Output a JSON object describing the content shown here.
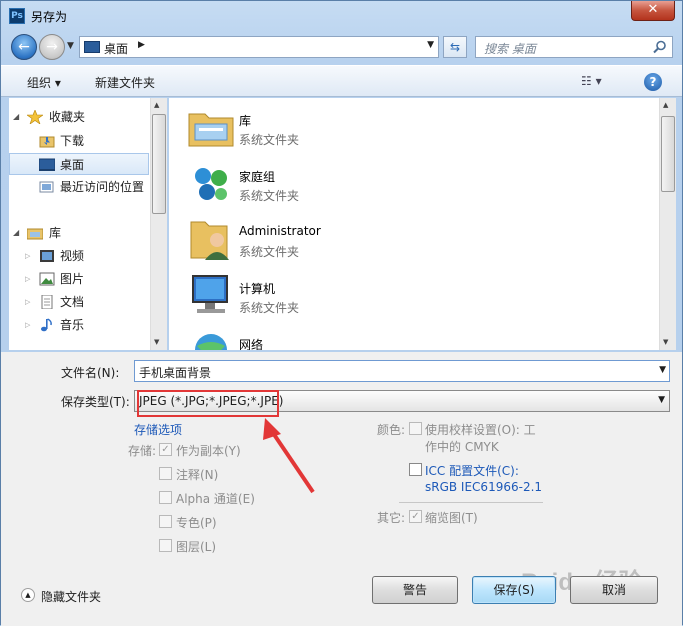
{
  "window": {
    "title": "另存为",
    "app_icon_text": "Ps"
  },
  "navbar": {
    "address": "桌面",
    "search_placeholder": "搜索 桌面"
  },
  "toolbar": {
    "organize": "组织 ▾",
    "new_folder": "新建文件夹",
    "help": "?"
  },
  "sidebar": {
    "items": [
      {
        "label": "收藏夹",
        "icon": "star-icon"
      },
      {
        "label": "下载",
        "icon": "download-folder-icon"
      },
      {
        "label": "桌面",
        "icon": "desktop-icon",
        "selected": true
      },
      {
        "label": "最近访问的位置",
        "icon": "recent-places-icon"
      },
      {
        "label": "库",
        "icon": "library-icon"
      },
      {
        "label": "视频",
        "icon": "video-icon"
      },
      {
        "label": "图片",
        "icon": "pictures-icon"
      },
      {
        "label": "文档",
        "icon": "documents-icon"
      },
      {
        "label": "音乐",
        "icon": "music-icon"
      }
    ]
  },
  "files": [
    {
      "name": "库",
      "type": "系统文件夹",
      "icon": "library-folder-icon"
    },
    {
      "name": "家庭组",
      "type": "系统文件夹",
      "icon": "homegroup-icon"
    },
    {
      "name": "Administrator",
      "type": "系统文件夹",
      "icon": "user-folder-icon"
    },
    {
      "name": "计算机",
      "type": "系统文件夹",
      "icon": "computer-icon"
    },
    {
      "name": "网络",
      "type": "",
      "icon": "network-icon"
    }
  ],
  "form": {
    "filename_label": "文件名(N):",
    "filename_value": "手机桌面背景",
    "filetype_label": "保存类型(T):",
    "filetype_value": "JPEG (*.JPG;*.JPEG;*.JPE)",
    "storage_options_link": "存储选项",
    "storage_label": "存储:",
    "storage_options": [
      {
        "label": "作为副本(Y)",
        "checked": true
      },
      {
        "label": "注释(N)",
        "checked": false
      },
      {
        "label": "Alpha 通道(E)",
        "checked": false
      },
      {
        "label": "专色(P)",
        "checked": false
      },
      {
        "label": "图层(L)",
        "checked": false
      }
    ],
    "color_label": "颜色:",
    "proof_setup": "使用校样设置(O): 工",
    "proof_setup_line2": "作中的 CMYK",
    "icc_profile": "ICC 配置文件(C):",
    "icc_value": "sRGB IEC61966-2.1",
    "other_label": "其它:",
    "thumbnail": "缩览图(T)"
  },
  "footer": {
    "hide_folders": "隐藏文件夹",
    "warning_button": "警告",
    "save_button": "保存(S)",
    "cancel_button": "取消"
  },
  "watermark": "Baidu 经验",
  "colors": {
    "highlight": "#e23737",
    "link": "#1d59b8"
  }
}
